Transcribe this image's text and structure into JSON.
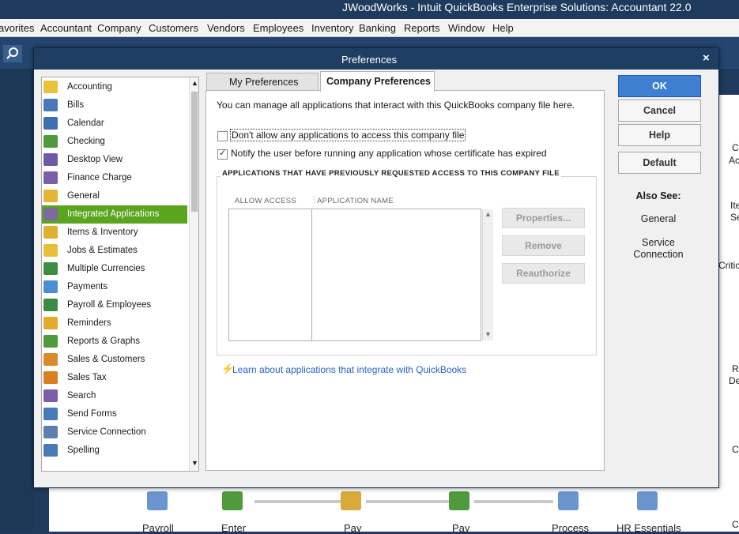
{
  "window": {
    "title": "JWoodWorks  - Intuit QuickBooks Enterprise Solutions: Accountant 22.0"
  },
  "menu": [
    {
      "label": "avorites"
    },
    {
      "label": "Accountant"
    },
    {
      "label": "Company"
    },
    {
      "label": "Customers"
    },
    {
      "label": "Vendors"
    },
    {
      "label": "Employees"
    },
    {
      "label": "Inventory"
    },
    {
      "label": "Banking"
    },
    {
      "label": "Reports"
    },
    {
      "label": "Window"
    },
    {
      "label": "Help"
    }
  ],
  "dialog": {
    "title": "Preferences",
    "close_icon": "×",
    "categories": [
      {
        "label": "Accounting",
        "icon": "accounting-icon",
        "color": "#e8c23a"
      },
      {
        "label": "Bills",
        "icon": "bills-icon",
        "color": "#4a79b8"
      },
      {
        "label": "Calendar",
        "icon": "calendar-icon",
        "color": "#3f6fb0"
      },
      {
        "label": "Checking",
        "icon": "checking-icon",
        "color": "#4f9a3d"
      },
      {
        "label": "Desktop View",
        "icon": "desktop-view-icon",
        "color": "#6d5ba6"
      },
      {
        "label": "Finance Charge",
        "icon": "finance-charge-icon",
        "color": "#7b5ea8"
      },
      {
        "label": "General",
        "icon": "general-icon",
        "color": "#e2b532"
      },
      {
        "label": "Integrated Applications",
        "icon": "integrated-apps-icon",
        "color": "#7d6a9e"
      },
      {
        "label": "Items & Inventory",
        "icon": "items-inventory-icon",
        "color": "#e0b030"
      },
      {
        "label": "Jobs & Estimates",
        "icon": "jobs-estimates-icon",
        "color": "#e6c03a"
      },
      {
        "label": "Multiple Currencies",
        "icon": "multiple-currencies-icon",
        "color": "#3f8d45"
      },
      {
        "label": "Payments",
        "icon": "payments-icon",
        "color": "#4c8fd1"
      },
      {
        "label": "Payroll & Employees",
        "icon": "payroll-employees-icon",
        "color": "#3e8a45"
      },
      {
        "label": "Reminders",
        "icon": "reminders-icon",
        "color": "#e5a92c"
      },
      {
        "label": "Reports & Graphs",
        "icon": "reports-graphs-icon",
        "color": "#4f9a3d"
      },
      {
        "label": "Sales & Customers",
        "icon": "sales-customers-icon",
        "color": "#d98b2b"
      },
      {
        "label": "Sales Tax",
        "icon": "sales-tax-icon",
        "color": "#d97f22"
      },
      {
        "label": "Search",
        "icon": "search-icon",
        "color": "#7b5ea8"
      },
      {
        "label": "Send Forms",
        "icon": "send-forms-icon",
        "color": "#4a79b8"
      },
      {
        "label": "Service Connection",
        "icon": "service-connection-icon",
        "color": "#5d7fb0"
      },
      {
        "label": "Spelling",
        "icon": "spelling-icon",
        "color": "#4a79b8"
      }
    ],
    "selected_category": "Integrated Applications",
    "tabs": {
      "my": "My Preferences",
      "company": "Company Preferences"
    },
    "intro": "You can manage all applications that interact with this QuickBooks company file here.",
    "checkbox1": {
      "label": "Don't allow any applications to access this company file",
      "checked": false
    },
    "checkbox2": {
      "label": "Notify the user before running any application whose certificate has expired",
      "checked": true
    },
    "group_title": "APPLICATIONS THAT HAVE PREVIOUSLY REQUESTED ACCESS TO THIS COMPANY FILE",
    "columns": {
      "allow": "ALLOW ACCESS",
      "name": "APPLICATION NAME"
    },
    "side_buttons": {
      "properties": "Properties...",
      "remove": "Remove",
      "reauthorize": "Reauthorize"
    },
    "learn_link": "Learn about applications that integrate with QuickBooks",
    "buttons": {
      "ok": "OK",
      "cancel": "Cancel",
      "help": "Help",
      "default": "Default"
    },
    "also_see": {
      "title": "Also See:",
      "general": "General",
      "service_connection": "Service Connection"
    }
  },
  "home": {
    "flow": [
      {
        "label": "Payroll"
      },
      {
        "label": "Enter"
      },
      {
        "label": "Pay"
      },
      {
        "label": "Pay"
      },
      {
        "label": "Process"
      },
      {
        "label": "HR Essentials"
      }
    ],
    "right_fragments": [
      "C",
      "Ac",
      "Ite",
      "Se",
      "Critic",
      "R",
      "De",
      "C",
      "C"
    ]
  }
}
